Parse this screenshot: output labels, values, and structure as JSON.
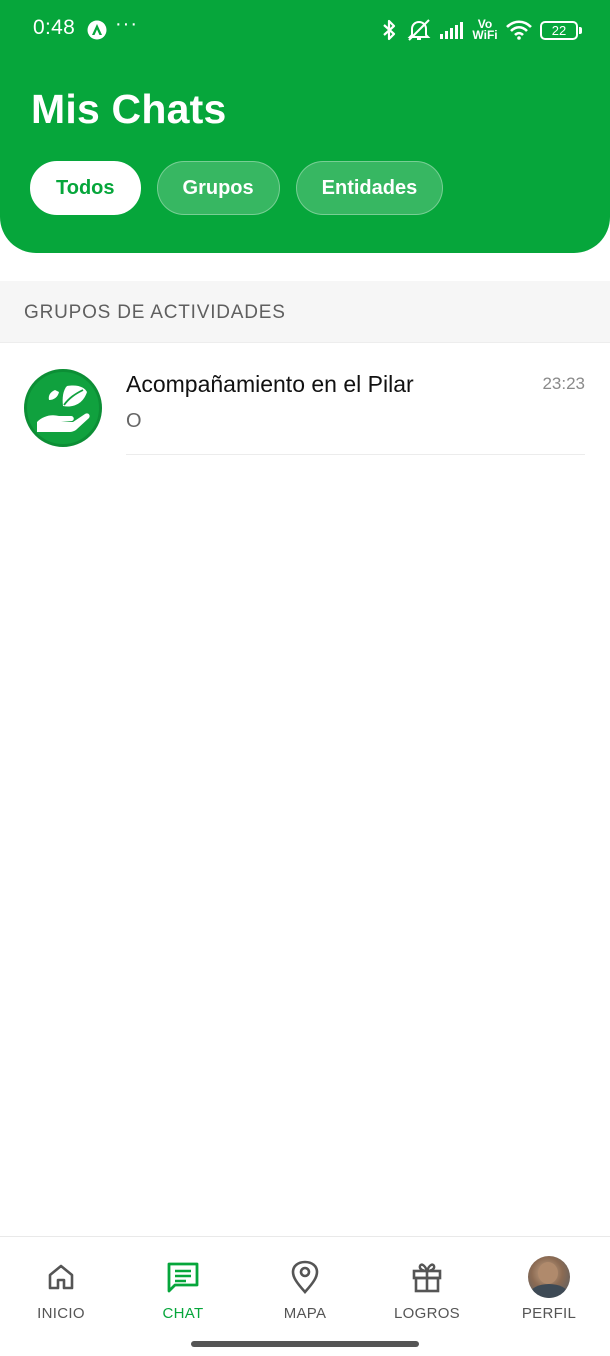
{
  "status_bar": {
    "time": "0:48",
    "dots": "···",
    "vowifi_top": "Vo",
    "vowifi_bottom": "WiFi",
    "battery": "22"
  },
  "header": {
    "title": "Mis Chats",
    "filters": [
      {
        "label": "Todos",
        "active": true
      },
      {
        "label": "Grupos",
        "active": false
      },
      {
        "label": "Entidades",
        "active": false
      }
    ]
  },
  "section": {
    "title": "GRUPOS DE ACTIVIDADES"
  },
  "chats": [
    {
      "name": "Acompañamiento en el Pilar",
      "time": "23:23",
      "preview": "O",
      "avatar_icon": "hand-leaf-icon"
    }
  ],
  "bottom_nav": [
    {
      "label": "INICIO",
      "icon": "home-icon",
      "active": false
    },
    {
      "label": "CHAT",
      "icon": "chat-icon",
      "active": true
    },
    {
      "label": "MAPA",
      "icon": "map-pin-icon",
      "active": false
    },
    {
      "label": "LOGROS",
      "icon": "gift-icon",
      "active": false
    },
    {
      "label": "PERFIL",
      "icon": "avatar",
      "active": false
    }
  ],
  "colors": {
    "brand_green": "#06a63b",
    "inactive_nav": "#555555"
  }
}
